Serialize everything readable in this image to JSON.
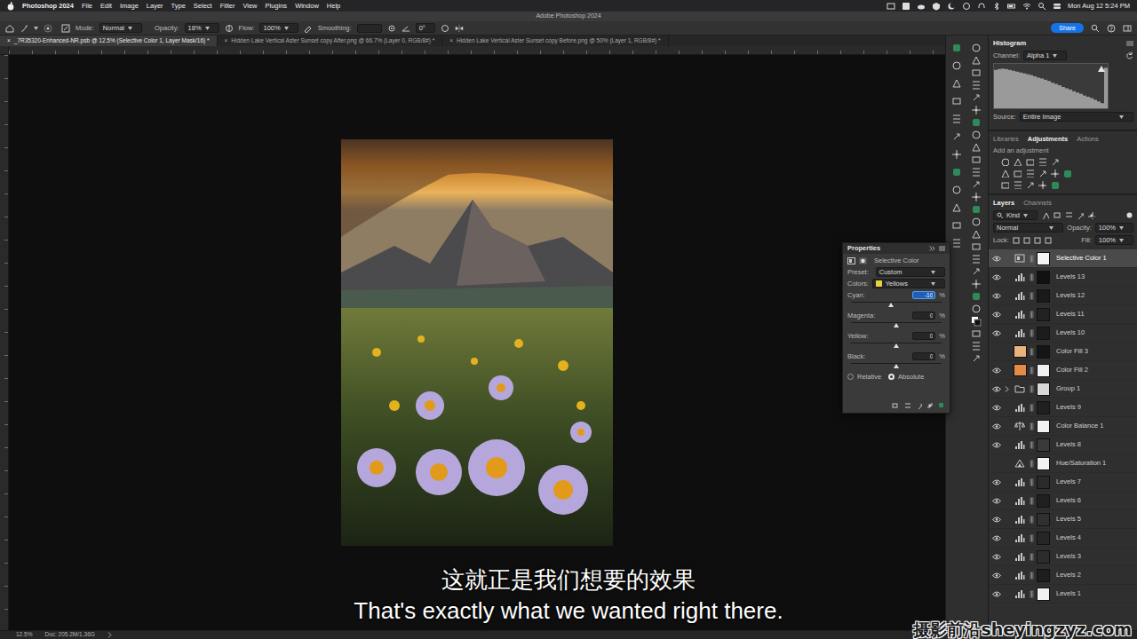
{
  "menubar": {
    "app": "Photoshop 2024",
    "menus": [
      "File",
      "Edit",
      "Image",
      "Layer",
      "Type",
      "Select",
      "Filter",
      "View",
      "Plugins",
      "Window",
      "Help"
    ],
    "clock": "Mon Aug 12  5:24 PM"
  },
  "window": {
    "title": "Adobe Photoshop 2024"
  },
  "options": {
    "mode_label": "Mode:",
    "mode": "Normal",
    "opacity_label": "Opacity:",
    "opacity": "18%",
    "flow_label": "Flow:",
    "flow": "100%",
    "smoothing_label": "Smoothing:",
    "angle": "0°",
    "share": "Share"
  },
  "documents": [
    {
      "close": "×",
      "label": "_7R35320-Enhanced-NR.psb @ 12.5% (Selective Color 1, Layer Mask/16) *",
      "selected": true
    },
    {
      "close": "×",
      "label": "Hidden Lake Vertical Aster Sunset copy After.png @ 66.7% (Layer 0, RGB/8#) *",
      "selected": false
    },
    {
      "close": "×",
      "label": "Hidden Lake Vertical Aster Sunset copy Before.png @ 50% (Layer 1, RGB/8#) *",
      "selected": false
    }
  ],
  "histogram": {
    "title": "Histogram",
    "channel_label": "Channel:",
    "channel": "Alpha 1",
    "source_label": "Source:",
    "source": "Entire Image",
    "values": [
      90,
      92,
      93,
      92,
      90,
      88,
      86,
      84,
      82,
      80,
      78,
      75,
      72,
      70,
      67,
      64,
      60,
      57,
      54,
      50,
      47,
      44,
      40,
      37,
      34,
      30,
      27,
      24,
      20,
      16,
      12,
      95
    ]
  },
  "adjustments": {
    "tabs": [
      {
        "label": "Libraries",
        "selected": false
      },
      {
        "label": "Adjustments",
        "selected": true
      },
      {
        "label": "Actions",
        "selected": false
      }
    ],
    "hint": "Add an adjustment"
  },
  "layers": {
    "tabs": [
      {
        "label": "Layers",
        "selected": true
      },
      {
        "label": "Channels",
        "selected": false
      }
    ],
    "filter": "Kind",
    "blend": "Normal",
    "opacity_label": "Opacity:",
    "opacity": "100%",
    "lock_label": "Lock:",
    "fill_label": "Fill:",
    "fill": "100%",
    "items": [
      {
        "name": "Selective Color 1",
        "kind": "selective-color",
        "visible": true,
        "selected": true,
        "mask": "#f4f4f4"
      },
      {
        "name": "Levels 13",
        "kind": "levels",
        "visible": true,
        "selected": false,
        "mask": "#111111"
      },
      {
        "name": "Levels 12",
        "kind": "levels",
        "visible": true,
        "selected": false,
        "mask": "#1a1a1a"
      },
      {
        "name": "Levels 11",
        "kind": "levels",
        "visible": true,
        "selected": false,
        "mask": "#222222"
      },
      {
        "name": "Levels 10",
        "kind": "levels",
        "visible": true,
        "selected": false,
        "mask": "#1c1c1c"
      },
      {
        "name": "Color Fill 3",
        "kind": "color-fill",
        "visible": false,
        "selected": false,
        "color": "#e8b47c",
        "mask": "#151515"
      },
      {
        "name": "Color Fill 2",
        "kind": "color-fill",
        "visible": true,
        "selected": false,
        "color": "#e38c4a",
        "mask": "#f0f0f0"
      },
      {
        "name": "Group 1",
        "kind": "group",
        "visible": true,
        "selected": false,
        "mask": "#d8d8d8"
      },
      {
        "name": "Levels 9",
        "kind": "levels",
        "visible": true,
        "selected": false,
        "mask": "#202020"
      },
      {
        "name": "Color Balance 1",
        "kind": "color-balance",
        "visible": true,
        "selected": false,
        "mask": "#f2f2f2"
      },
      {
        "name": "Levels 8",
        "kind": "levels",
        "visible": true,
        "selected": false,
        "mask": "#3a3a3a"
      },
      {
        "name": "Hue/Saturation 1",
        "kind": "hue-saturation",
        "visible": false,
        "selected": false,
        "mask": "#f2f2f2"
      },
      {
        "name": "Levels 7",
        "kind": "levels",
        "visible": true,
        "selected": false,
        "mask": "#2a2a2a"
      },
      {
        "name": "Levels 6",
        "kind": "levels",
        "visible": true,
        "selected": false,
        "mask": "#202020"
      },
      {
        "name": "Levels 5",
        "kind": "levels",
        "visible": true,
        "selected": false,
        "mask": "#303030"
      },
      {
        "name": "Levels 4",
        "kind": "levels",
        "visible": true,
        "selected": false,
        "mask": "#262626"
      },
      {
        "name": "Levels 3",
        "kind": "levels",
        "visible": true,
        "selected": false,
        "mask": "#2c2c2c"
      },
      {
        "name": "Levels 2",
        "kind": "levels",
        "visible": true,
        "selected": false,
        "mask": "#1e1e1e"
      },
      {
        "name": "Levels 1",
        "kind": "levels",
        "visible": true,
        "selected": false,
        "mask": "#f0f0f0"
      }
    ]
  },
  "properties": {
    "title": "Properties",
    "type": "Selective Color",
    "preset_label": "Preset:",
    "preset": "Custom",
    "colors_label": "Colors:",
    "colors": "Yellows",
    "colors_color": "#e8d23a",
    "sliders": [
      {
        "label": "Cyan:",
        "value": "-10",
        "unit": "%",
        "level": 0.44,
        "focused": true
      },
      {
        "label": "Magenta:",
        "value": "0",
        "unit": "%",
        "level": 0.5,
        "focused": false
      },
      {
        "label": "Yellow:",
        "value": "0",
        "unit": "%",
        "level": 0.5,
        "focused": false
      },
      {
        "label": "Black:",
        "value": "0",
        "unit": "%",
        "level": 0.5,
        "focused": false
      }
    ],
    "methods": [
      {
        "label": "Relative",
        "selected": false
      },
      {
        "label": "Absolute",
        "selected": true
      }
    ]
  },
  "subtitles": {
    "zh": "这就正是我们想要的效果",
    "en": "That's exactly what we wanted right there."
  },
  "watermark": "摄影前沿sheyingzyz.com",
  "status": {
    "zoom": "12.5%",
    "doc": "Doc: 205.2M/1.36G"
  }
}
